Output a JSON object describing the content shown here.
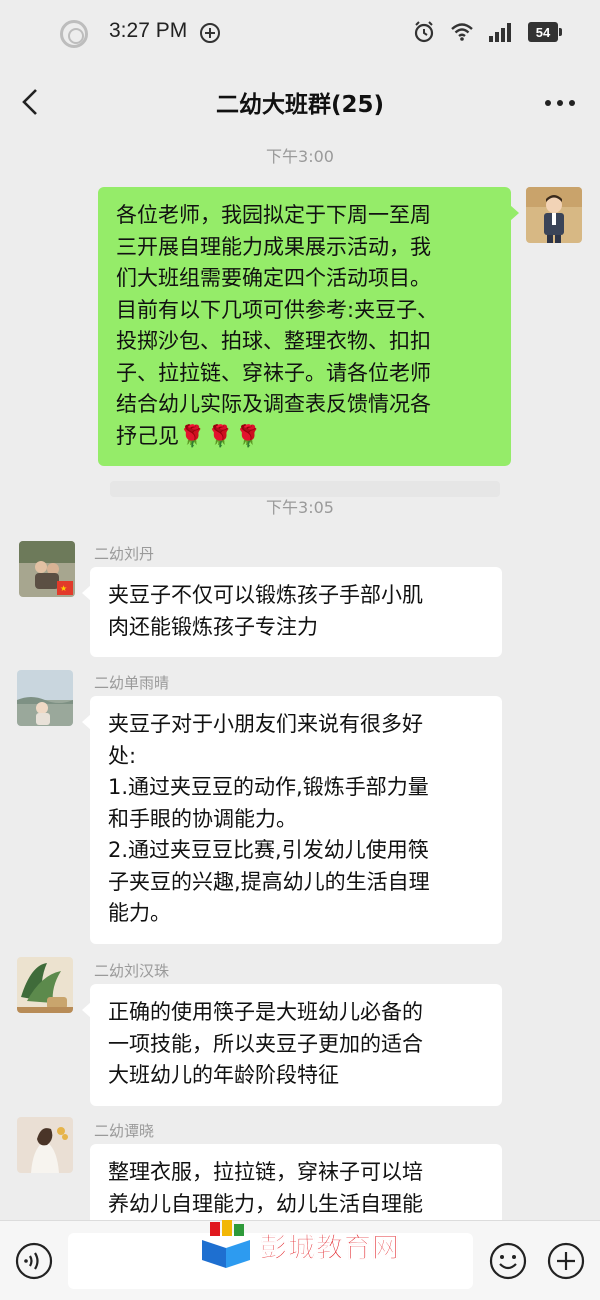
{
  "status_bar": {
    "time": "3:27 PM",
    "battery": "54",
    "icons": [
      "circle-icon",
      "network-icon",
      "alarm-icon",
      "wifi-icon",
      "signal-icon",
      "battery-icon"
    ]
  },
  "nav": {
    "title": "二幼大班群(25)",
    "back_icon": "chevron-left-icon",
    "more_icon": "more-dots-icon"
  },
  "messages": {
    "time_1": "下午3:00",
    "time_2": "下午3:05",
    "m1": {
      "lines": [
        "各位老师，我园拟定于下周一至周",
        "三开展自理能力成果展示活动，我",
        "们大班组需要确定四个活动项目。",
        "目前有以下几项可供参考:夹豆子、",
        "投掷沙包、拍球、整理衣物、扣扣",
        "子、拉拉链、穿袜子。请各位老师",
        "结合幼儿实际及调查表反馈情况各",
        "抒己见"
      ],
      "emoji": "🌹🌹🌹"
    },
    "m2": {
      "sender": "二幼刘丹",
      "lines": [
        "夹豆子不仅可以锻炼孩子手部小肌",
        "肉还能锻炼孩子专注力"
      ]
    },
    "m3": {
      "sender": "二幼单雨晴",
      "lines": [
        "夹豆子对于小朋友们来说有很多好",
        "处:",
        "1.通过夹豆豆的动作,锻炼手部力量",
        "和手眼的协调能力。",
        "2.通过夹豆豆比赛,引发幼儿使用筷",
        "子夹豆的兴趣,提高幼儿的生活自理",
        "能力。"
      ]
    },
    "m4": {
      "sender": "二幼刘汉珠",
      "lines": [
        "正确的使用筷子是大班幼儿必备的",
        "一项技能，所以夹豆子更加的适合",
        "大班幼儿的年龄阶段特征"
      ]
    },
    "m5": {
      "sender": "二幼谭晓",
      "lines": [
        "整理衣服，拉拉链，穿袜子可以培",
        "养幼儿自理能力，幼儿生活自理能"
      ]
    }
  },
  "input_bar": {
    "voice_icon": "voice-icon",
    "emoji_icon": "emoji-icon",
    "plus_icon": "plus-icon"
  },
  "watermark": {
    "text": "彭城教育网"
  },
  "colors": {
    "background": "#ededed",
    "my_bubble": "#95ec69",
    "other_bubble": "#ffffff",
    "watermark": "#e0181e"
  }
}
